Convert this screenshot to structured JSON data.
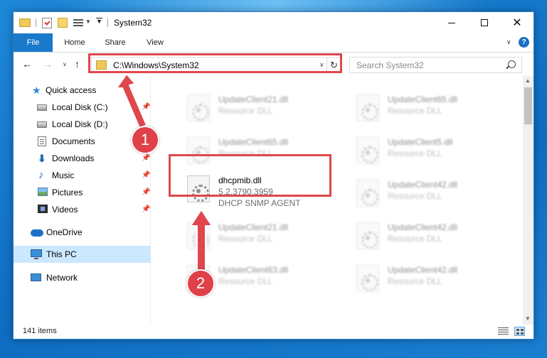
{
  "window": {
    "title": "System32",
    "controls": {
      "minimize": "",
      "maximize": "",
      "close": "✕"
    }
  },
  "ribbon": {
    "tabs": [
      "File",
      "Home",
      "Share",
      "View"
    ],
    "help": "?"
  },
  "address": {
    "path": "C:\\Windows\\System32",
    "search_placeholder": "Search System32"
  },
  "sidebar": {
    "items": [
      {
        "label": "Quick access",
        "icon": "star-icon"
      },
      {
        "label": "Local Disk (C:)",
        "icon": "disk-icon",
        "pinned": true
      },
      {
        "label": "Local Disk (D:)",
        "icon": "disk-icon"
      },
      {
        "label": "Documents",
        "icon": "documents-icon",
        "pinned": true
      },
      {
        "label": "Downloads",
        "icon": "downloads-icon",
        "pinned": true
      },
      {
        "label": "Music",
        "icon": "music-icon",
        "pinned": true
      },
      {
        "label": "Pictures",
        "icon": "pictures-icon",
        "pinned": true
      },
      {
        "label": "Videos",
        "icon": "videos-icon",
        "pinned": true
      },
      {
        "label": "OneDrive",
        "icon": "onedrive-icon"
      },
      {
        "label": "This PC",
        "icon": "pc-icon",
        "selected": true
      },
      {
        "label": "Network",
        "icon": "network-icon"
      }
    ]
  },
  "files": [
    {
      "name": "UpdateClient21.dll",
      "desc": "Resource DLL",
      "blurred": true
    },
    {
      "name": "UpdateClient65.dll",
      "desc": "Resource DLL",
      "blurred": true
    },
    {
      "name": "UpdateClient65.dll",
      "desc": "Resource DLL",
      "blurred": true
    },
    {
      "name": "UpdateClient5.dll",
      "desc": "Resource DLL",
      "blurred": true
    },
    {
      "name": "dhcpmib.dll",
      "version": "5.2.3790.3959",
      "desc": "DHCP SNMP AGENT",
      "blurred": false
    },
    {
      "name": "UpdateClient42.dll",
      "desc": "Resource DLL",
      "blurred": true
    },
    {
      "name": "UpdateClient21.dll",
      "desc": "Resource DLL",
      "blurred": true
    },
    {
      "name": "UpdateClient42.dll",
      "desc": "Resource DLL",
      "blurred": true
    },
    {
      "name": "UpdateClient63.dll",
      "desc": "Resource DLL",
      "blurred": true
    },
    {
      "name": "UpdateClient42.dll",
      "desc": "Resource DLL",
      "blurred": true
    }
  ],
  "status": {
    "items_count": "141 items"
  },
  "annotations": {
    "step1": "1",
    "step2": "2",
    "color": "#e0474c"
  }
}
